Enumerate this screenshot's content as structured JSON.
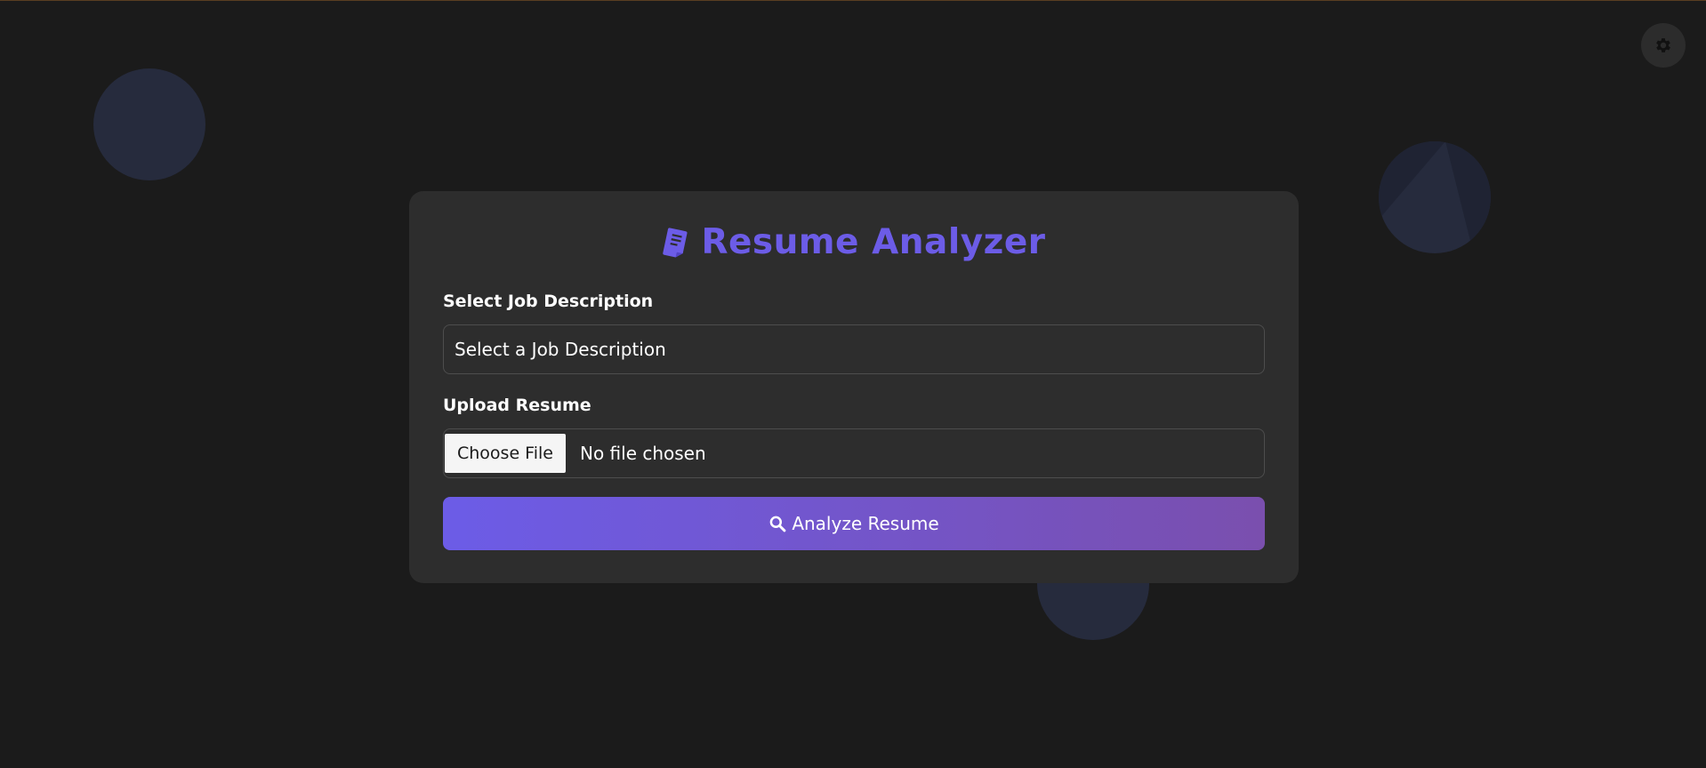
{
  "app": {
    "title": "Resume Analyzer"
  },
  "icons": {
    "title_icon": "file-icon",
    "theme_toggle": "gear-icon",
    "analyze_button_icon": "search-icon"
  },
  "colors": {
    "background": "#1b1b1b",
    "card": "#2d2d2d",
    "accent": "#6c5ce7",
    "button_gradient_end": "#7a4fae",
    "decor_circle": "#262b3d"
  },
  "form": {
    "job_label": "Select Job Description",
    "job_select_value": "Select a Job Description",
    "upload_label": "Upload Resume",
    "choose_file_label": "Choose File",
    "file_status": "No file chosen",
    "analyze_label": "Analyze Resume"
  }
}
